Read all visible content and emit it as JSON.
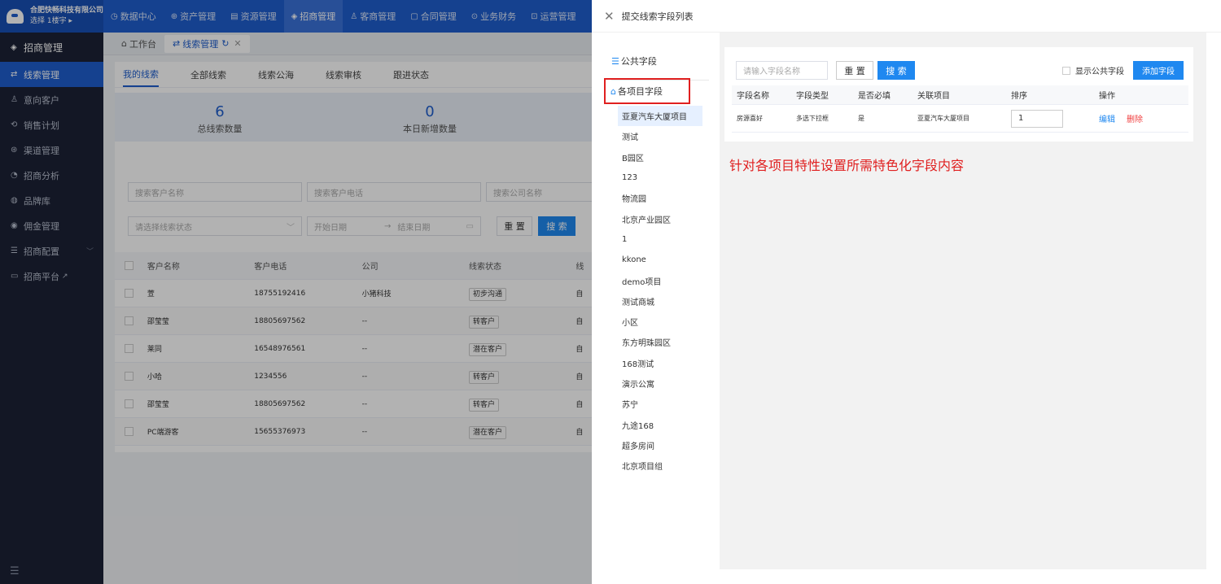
{
  "app": {
    "company": "合肥快畅科技有限公司",
    "building_select": "选择 1楼宇 ▸"
  },
  "topnav": [
    {
      "label": "数据中心",
      "icon": "◷"
    },
    {
      "label": "资产管理",
      "icon": "⊕"
    },
    {
      "label": "资源管理",
      "icon": "▤"
    },
    {
      "label": "招商管理",
      "icon": "◈"
    },
    {
      "label": "客商管理",
      "icon": "♙"
    },
    {
      "label": "合同管理",
      "icon": "▢"
    },
    {
      "label": "业务财务",
      "icon": "⊙"
    },
    {
      "label": "运营管理",
      "icon": "⊡"
    }
  ],
  "sidebar": {
    "head": "招商管理",
    "items": [
      {
        "label": "线索管理",
        "icon": "⇄"
      },
      {
        "label": "意向客户",
        "icon": "♙"
      },
      {
        "label": "销售计划",
        "icon": "⟲"
      },
      {
        "label": "渠道管理",
        "icon": "⊛"
      },
      {
        "label": "招商分析",
        "icon": "◔"
      },
      {
        "label": "品牌库",
        "icon": "◍"
      },
      {
        "label": "佣金管理",
        "icon": "◉"
      },
      {
        "label": "招商配置",
        "icon": "☰"
      },
      {
        "label": "招商平台",
        "icon": "▭"
      }
    ],
    "bottom_icon": "☰"
  },
  "tabs": {
    "home": "工作台",
    "current": "线索管理"
  },
  "subtabs": [
    "我的线索",
    "全部线索",
    "线索公海",
    "线索审核",
    "跟进状态"
  ],
  "stats": [
    {
      "value": "6",
      "label": "总线索数量"
    },
    {
      "value": "0",
      "label": "本日新增数量"
    }
  ],
  "filters": {
    "customer_name": "搜索客户名称",
    "customer_phone": "搜索客户电话",
    "company_name": "搜索公司名称",
    "lead_status": "请选择线索状态",
    "start_date": "开始日期",
    "date_sep": "→",
    "end_date": "结束日期",
    "reset": "重 置",
    "search": "搜 索"
  },
  "leads_table": {
    "headers": [
      "客户名称",
      "客户电话",
      "公司",
      "线索状态",
      "线"
    ],
    "rows": [
      [
        "萱",
        "18755192416",
        "小猪科技",
        "初步沟通",
        "自"
      ],
      [
        "邵莹莹",
        "18805697562",
        "--",
        "转客户",
        "自"
      ],
      [
        "莱同",
        "16548976561",
        "--",
        "潜在客户",
        "自"
      ],
      [
        "小哈",
        "1234556",
        "--",
        "转客户",
        "自"
      ],
      [
        "邵莹莹",
        "18805697562",
        "--",
        "转客户",
        "自"
      ],
      [
        "PC端游客",
        "15655376973",
        "--",
        "潜在客户",
        "自"
      ]
    ]
  },
  "drawer": {
    "title": "提交线索字段列表",
    "public_fields": "公共字段",
    "project_fields": "各项目字段",
    "projects": [
      "亚夏汽车大厦项目",
      "测试",
      "B园区",
      "123",
      "物流园",
      "北京产业园区",
      "1",
      "kkone",
      "demo项目",
      "测试商城",
      "小区",
      "东方明珠园区",
      "168测试",
      "演示公寓",
      "苏宁",
      "九途168",
      "超多房间",
      "北京项目组"
    ],
    "search_placeholder": "请输入字段名称",
    "reset": "重 置",
    "search": "搜 索",
    "show_public": "显示公共字段",
    "add_field": "添加字段",
    "table": {
      "headers": [
        "字段名称",
        "字段类型",
        "是否必填",
        "关联项目",
        "排序",
        "操作"
      ],
      "row": {
        "name": "房源喜好",
        "type": "多选下拉框",
        "required": "是",
        "project": "亚夏汽车大厦项目",
        "sort": "1",
        "edit": "编辑",
        "delete": "删除"
      }
    },
    "annotation": "针对各项目特性设置所需特色化字段内容"
  }
}
